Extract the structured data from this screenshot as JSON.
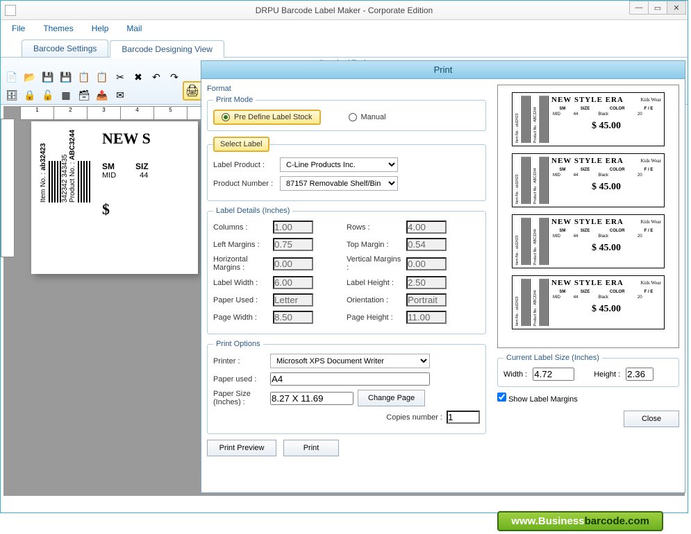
{
  "window": {
    "title": "DRPU Barcode Label Maker - Corporate Edition"
  },
  "menu": {
    "file": "File",
    "themes": "Themes",
    "help": "Help",
    "mail": "Mail"
  },
  "tabs": {
    "settings": "Barcode Settings",
    "design": "Barcode Designing View"
  },
  "ribbon": {
    "group": "Standard Tools"
  },
  "dialog": {
    "title": "Print",
    "format": "Format",
    "print_mode": {
      "legend": "Print Mode",
      "predefine": "Pre Define Label Stock",
      "manual": "Manual"
    },
    "select_label": {
      "legend": "Select Label",
      "product_lbl": "Label Product :",
      "product_val": "C-Line Products Inc.",
      "number_lbl": "Product Number :",
      "number_val": "87157 Removable Shelf/Bin"
    },
    "details": {
      "legend": "Label Details (Inches)",
      "columns_lbl": "Columns :",
      "columns": "1.00",
      "rows_lbl": "Rows :",
      "rows": "4.00",
      "lmargin_lbl": "Left Margins :",
      "lmargin": "0.75",
      "tmargin_lbl": "Top Margin :",
      "tmargin": "0.54",
      "hmargin_lbl": "Horizontal Margins :",
      "hmargin": "0.00",
      "vmargin_lbl": "Vertical Margins :",
      "vmargin": "0.00",
      "lwidth_lbl": "Label Width :",
      "lwidth": "6.00",
      "lheight_lbl": "Label Height :",
      "lheight": "2.50",
      "paper_lbl": "Paper Used :",
      "paper": "Letter",
      "orient_lbl": "Orientation :",
      "orient": "Portrait",
      "pwidth_lbl": "Page Width :",
      "pwidth": "8.50",
      "pheight_lbl": "Page Height :",
      "pheight": "11.00"
    },
    "options": {
      "legend": "Print Options",
      "printer_lbl": "Printer :",
      "printer": "Microsoft XPS Document Writer",
      "paper_lbl": "Paper used :",
      "paper": "A4",
      "size_lbl": "Paper Size (Inches) :",
      "size": "8.27 X 11.69",
      "change": "Change Page",
      "copies_lbl": "Copies number :",
      "copies": "1"
    },
    "cursize": {
      "legend": "Current Label Size (Inches)",
      "width_lbl": "Width :",
      "width": "4.72",
      "height_lbl": "Height :",
      "height": "2.36"
    },
    "show_margins": "Show Label Margins",
    "preview_btn": "Print Preview",
    "print_btn": "Print",
    "close_btn": "Close"
  },
  "label": {
    "brand": "NEW STYLE ERA",
    "sub": "Kids Wear",
    "headers": {
      "sm": "SM",
      "size": "SIZE",
      "color": "COLOR",
      "fe": "F / E"
    },
    "values": {
      "sm": "MID",
      "size": "44",
      "color": "Black",
      "fe": "20"
    },
    "price": "$ 45.00",
    "item_lbl": "Item No. :",
    "item": "ab32423",
    "prod_lbl": "Product No. :",
    "prod": "ABC3244",
    "bc1": "342342",
    "bc2": "343435"
  },
  "canvas": {
    "brand_short": "NEW S",
    "sm": "SM",
    "size": "SIZ",
    "mid": "MID",
    "n44": "44",
    "dollar": "$"
  },
  "ruler": [
    "1",
    "2",
    "3",
    "4",
    "5"
  ],
  "footer": {
    "pre": "www.",
    "mid": "Business",
    "post": "barcode.com"
  }
}
